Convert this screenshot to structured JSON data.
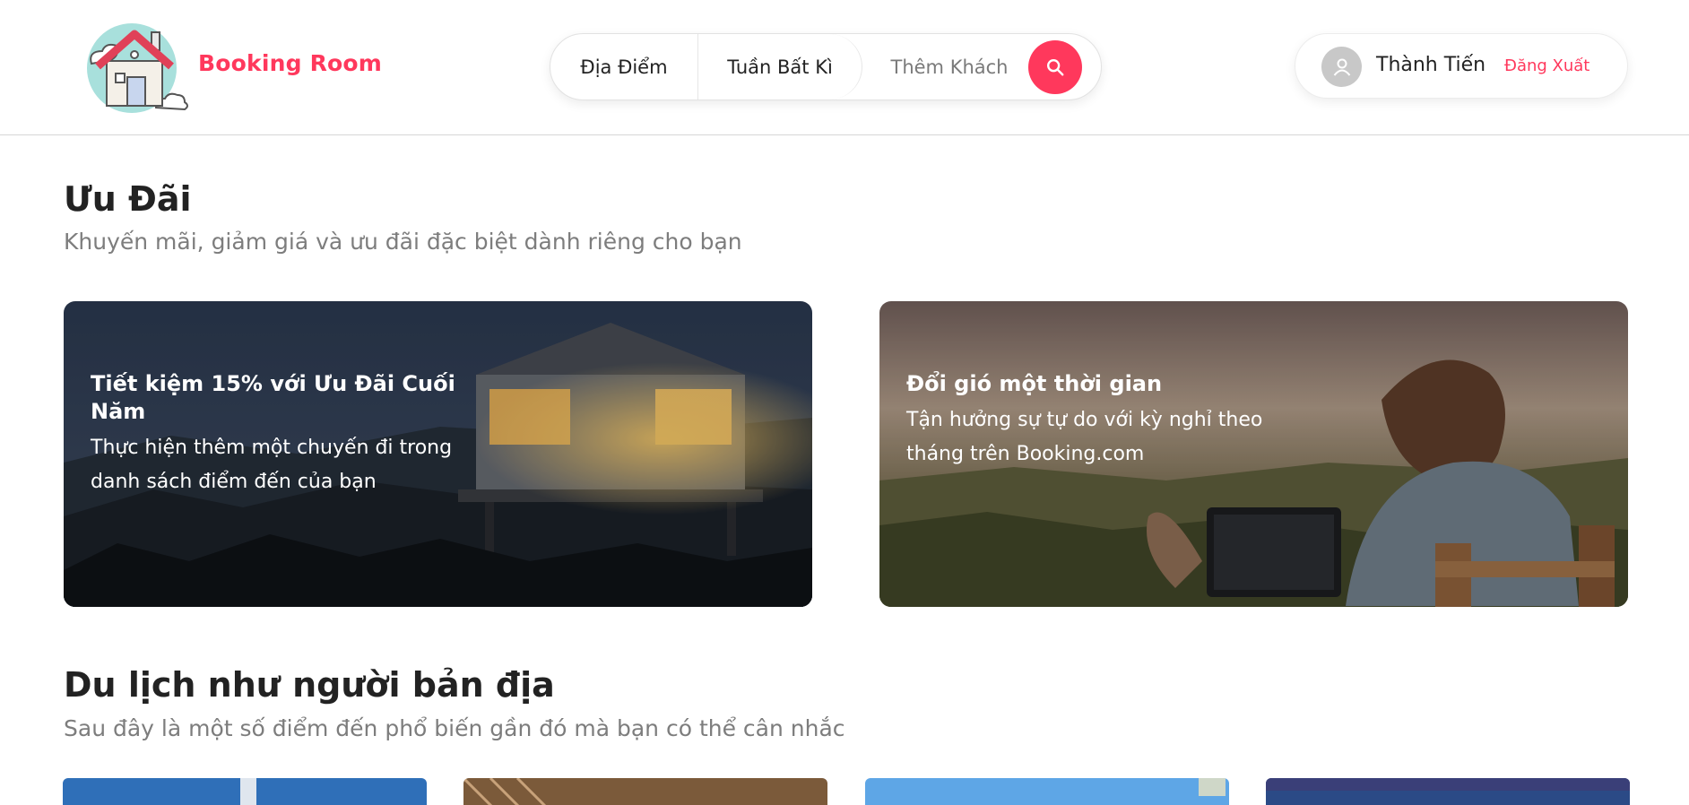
{
  "header": {
    "brand": "Booking Room",
    "search": {
      "location_label": "Địa Điểm",
      "week_label": "Tuần Bất Kì",
      "guest_label": "Thêm Khách"
    },
    "user": {
      "name": "Thành Tiến",
      "logout_label": "Đăng Xuất"
    }
  },
  "offers": {
    "title": "Ưu Đãi",
    "subtitle": "Khuyến mãi, giảm giá và ưu đãi đặc biệt dành riêng cho bạn",
    "cards": [
      {
        "title": "Tiết kiệm 15% với Ưu Đãi Cuối Năm",
        "desc_line1": "Thực hiện thêm một chuyến đi trong",
        "desc_line2": "danh sách điểm đến của bạn"
      },
      {
        "title": "Đổi gió một thời gian",
        "desc_line1": "Tận hưởng sự tự do với kỳ nghỉ theo",
        "desc_line2": "tháng trên Booking.com"
      }
    ]
  },
  "local": {
    "title": "Du lịch như người bản địa",
    "subtitle": "Sau đây là một số điểm đến phổ biến gần đó mà bạn có thể cân nhắc"
  },
  "colors": {
    "accent": "#ff385c",
    "text": "#222222",
    "muted": "#7d7d7d"
  },
  "icons": [
    "house-logo-icon",
    "search-icon",
    "user-avatar-icon"
  ]
}
